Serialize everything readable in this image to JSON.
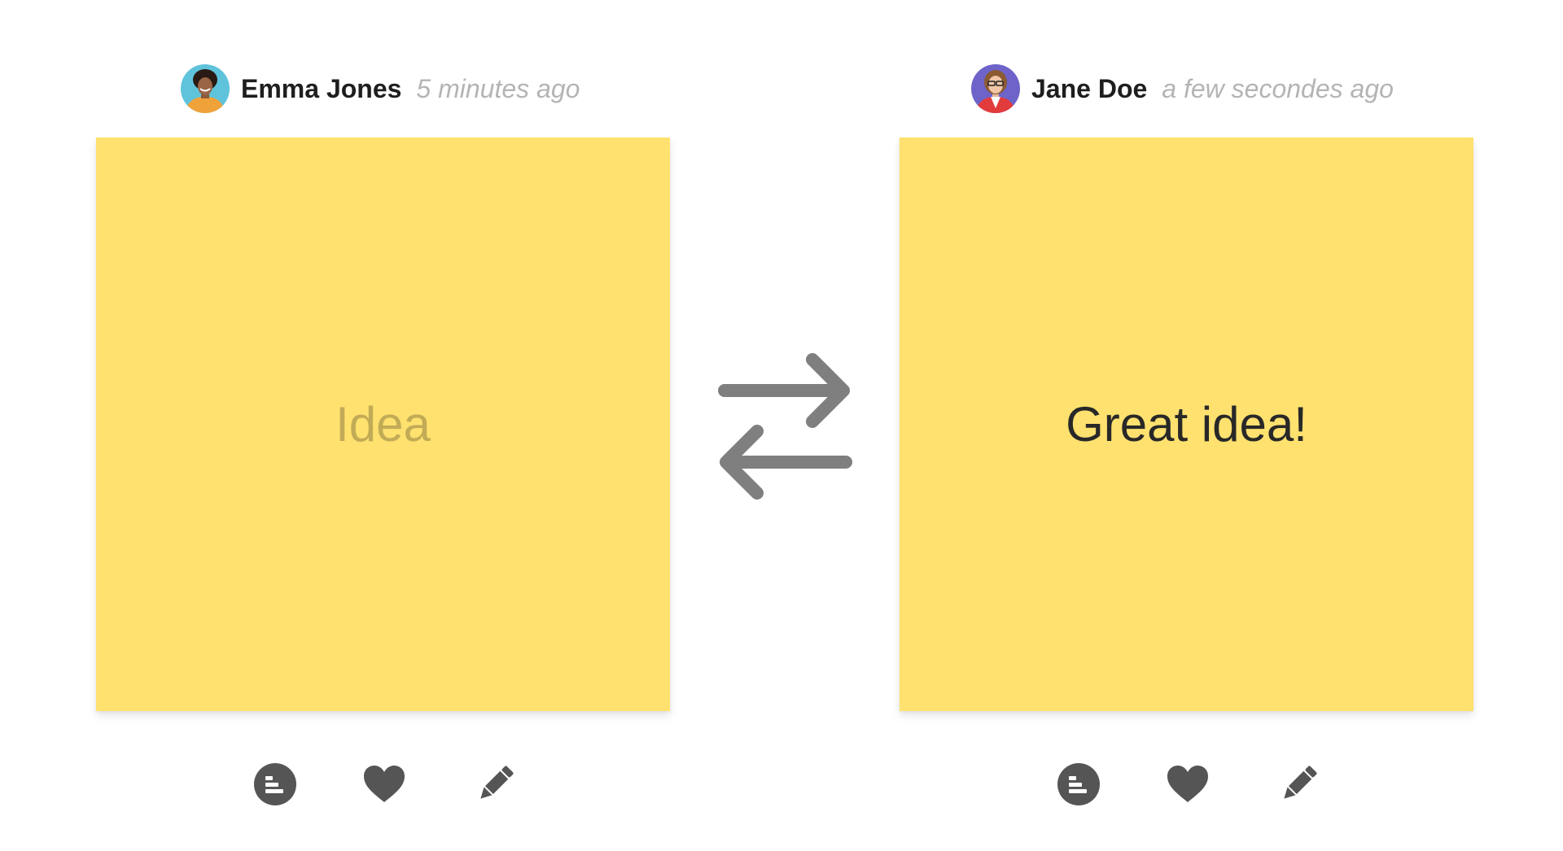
{
  "left_card": {
    "author": "Emma Jones",
    "timestamp": "5 minutes ago",
    "note_text": "Idea",
    "note_color": "#fee16f",
    "actions": [
      "comment-icon",
      "heart-icon",
      "pencil-icon"
    ]
  },
  "right_card": {
    "author": "Jane Doe",
    "timestamp": "a few secondes ago",
    "note_text": "Great idea!",
    "note_color": "#fee16f",
    "actions": [
      "comment-icon",
      "heart-icon",
      "pencil-icon"
    ]
  },
  "center": {
    "icon": "swap-arrows-icon"
  },
  "colors": {
    "note": "#fee16f",
    "icon": "#555555",
    "arrow": "#7f7f7f",
    "timestamp": "#b4b4b4"
  }
}
